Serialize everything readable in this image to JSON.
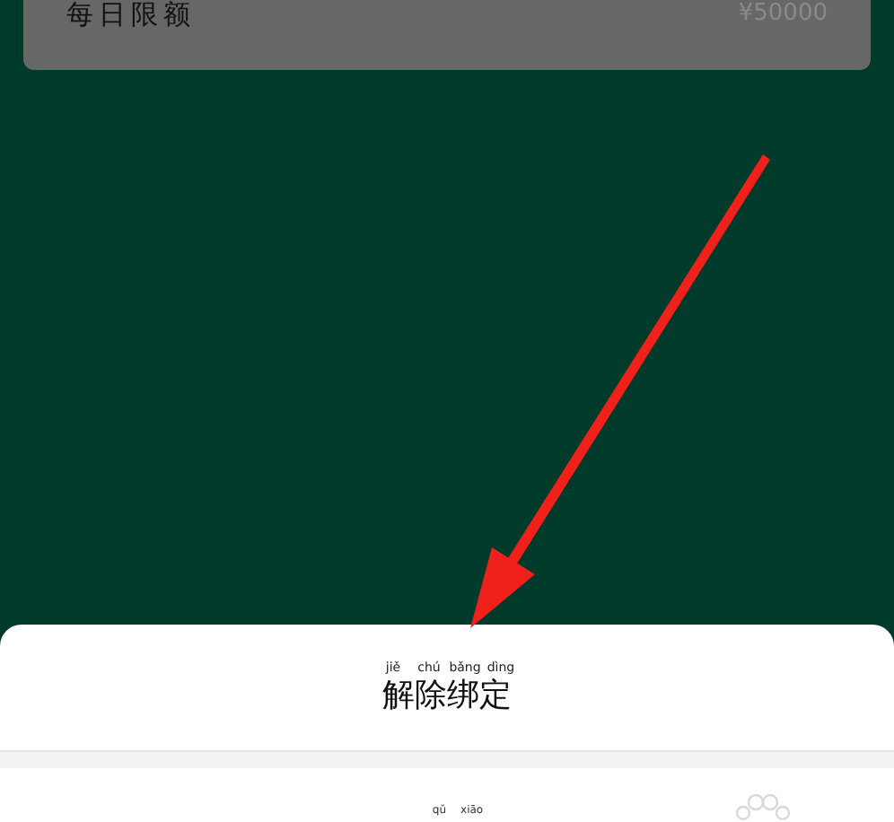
{
  "limit_card": {
    "label": "每日限额",
    "value": "¥50000"
  },
  "sheet": {
    "title": {
      "text": "解除绑定",
      "pinyin": [
        "jiě",
        "chú",
        "bǎng",
        "dìng"
      ]
    },
    "cancel": {
      "pinyin": [
        "qǔ",
        "xiāo"
      ]
    }
  }
}
